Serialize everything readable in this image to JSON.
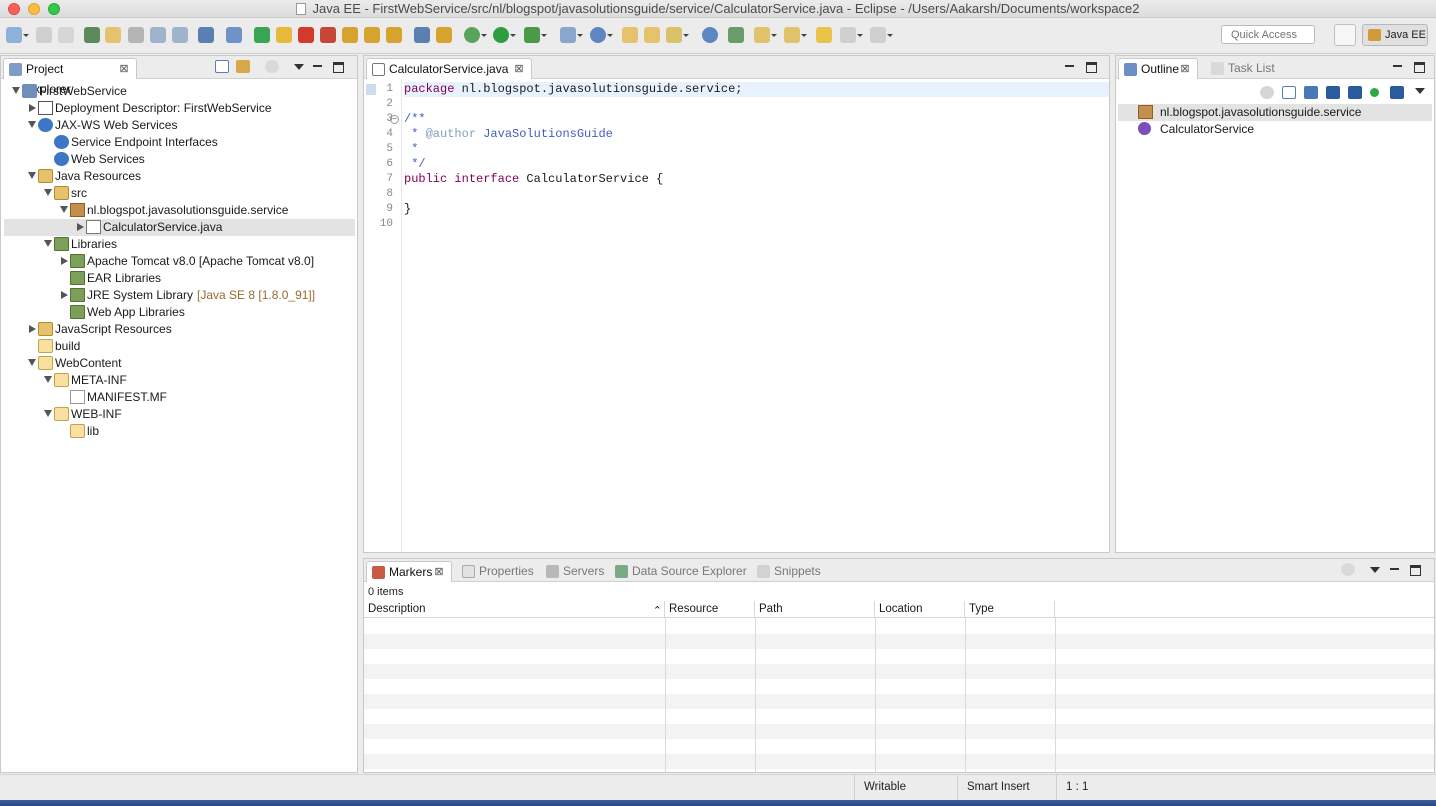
{
  "window": {
    "title": "Java EE - FirstWebService/src/nl/blogspot/javasolutionsguide/service/CalculatorService.java - Eclipse - /Users/Aakarsh/Documents/workspace2"
  },
  "toolbar": {
    "quick_access_placeholder": "Quick Access",
    "perspective_label": "Java EE"
  },
  "project_explorer": {
    "tab_label": "Project Explorer",
    "tree": [
      {
        "label": "FirstWebService",
        "depth": 0,
        "twisty": "down",
        "icon": "project-icon"
      },
      {
        "label": "Deployment Descriptor: FirstWebService",
        "depth": 1,
        "twisty": "right",
        "icon": "deployment-descriptor-icon"
      },
      {
        "label": "JAX-WS Web Services",
        "depth": 1,
        "twisty": "down",
        "icon": "web-services-icon"
      },
      {
        "label": "Service Endpoint Interfaces",
        "depth": 2,
        "twisty": "none",
        "icon": "interfaces-icon"
      },
      {
        "label": "Web Services",
        "depth": 2,
        "twisty": "none",
        "icon": "web-services-icon"
      },
      {
        "label": "Java Resources",
        "depth": 1,
        "twisty": "down",
        "icon": "java-resources-icon"
      },
      {
        "label": "src",
        "depth": 2,
        "twisty": "down",
        "icon": "source-folder-icon"
      },
      {
        "label": "nl.blogspot.javasolutionsguide.service",
        "depth": 3,
        "twisty": "down",
        "icon": "package-icon"
      },
      {
        "label": "CalculatorService.java",
        "depth": 4,
        "twisty": "right",
        "icon": "java-file-icon",
        "selected": true
      },
      {
        "label": "Libraries",
        "depth": 2,
        "twisty": "down",
        "icon": "libraries-icon"
      },
      {
        "label": "Apache Tomcat v8.0 [Apache Tomcat v8.0]",
        "depth": 3,
        "twisty": "right",
        "icon": "library-icon"
      },
      {
        "label": "EAR Libraries",
        "depth": 3,
        "twisty": "none",
        "icon": "library-icon"
      },
      {
        "label": "JRE System Library",
        "decoration": "[Java SE 8 [1.8.0_91]]",
        "depth": 3,
        "twisty": "right",
        "icon": "library-icon"
      },
      {
        "label": "Web App Libraries",
        "depth": 3,
        "twisty": "none",
        "icon": "library-icon"
      },
      {
        "label": "JavaScript Resources",
        "depth": 1,
        "twisty": "right",
        "icon": "javascript-resources-icon"
      },
      {
        "label": "build",
        "depth": 1,
        "twisty": "none",
        "icon": "folder-icon"
      },
      {
        "label": "WebContent",
        "depth": 1,
        "twisty": "down",
        "icon": "folder-icon"
      },
      {
        "label": "META-INF",
        "depth": 2,
        "twisty": "down",
        "icon": "folder-icon"
      },
      {
        "label": "MANIFEST.MF",
        "depth": 3,
        "twisty": "none",
        "icon": "file-icon"
      },
      {
        "label": "WEB-INF",
        "depth": 2,
        "twisty": "down",
        "icon": "folder-icon"
      },
      {
        "label": "lib",
        "depth": 3,
        "twisty": "none",
        "icon": "folder-icon"
      }
    ]
  },
  "editor": {
    "tab_label": "CalculatorService.java",
    "lines": [
      {
        "n": "1",
        "tokens": [
          {
            "t": "package",
            "c": "kw"
          },
          {
            "t": " nl.blogspot.javasolutionsguide.service;",
            "c": ""
          }
        ]
      },
      {
        "n": "2",
        "tokens": []
      },
      {
        "n": "3",
        "tokens": [
          {
            "t": "/**",
            "c": "cm"
          }
        ]
      },
      {
        "n": "4",
        "tokens": [
          {
            "t": " * ",
            "c": "cm"
          },
          {
            "t": "@author",
            "c": "tag"
          },
          {
            "t": " JavaSolutionsGuide",
            "c": "cm"
          }
        ]
      },
      {
        "n": "5",
        "tokens": [
          {
            "t": " *",
            "c": "cm"
          }
        ]
      },
      {
        "n": "6",
        "tokens": [
          {
            "t": " */",
            "c": "cm"
          }
        ]
      },
      {
        "n": "7",
        "tokens": [
          {
            "t": "public",
            "c": "kw"
          },
          {
            "t": " ",
            "c": ""
          },
          {
            "t": "interface",
            "c": "kw"
          },
          {
            "t": " CalculatorService {",
            "c": ""
          }
        ]
      },
      {
        "n": "8",
        "tokens": []
      },
      {
        "n": "9",
        "tokens": [
          {
            "t": "}",
            "c": ""
          }
        ]
      },
      {
        "n": "10",
        "tokens": []
      }
    ]
  },
  "outline": {
    "tabs": [
      "Outline",
      "Task List"
    ],
    "items": [
      {
        "label": "nl.blogspot.javasolutionsguide.service",
        "icon": "package-icon",
        "selected": true
      },
      {
        "label": "CalculatorService",
        "icon": "interface-icon"
      }
    ]
  },
  "bottom": {
    "tabs": [
      "Markers",
      "Properties",
      "Servers",
      "Data Source Explorer",
      "Snippets"
    ],
    "items_count": "0 items",
    "columns": [
      "Description",
      "Resource",
      "Path",
      "Location",
      "Type"
    ]
  },
  "status": {
    "writable": "Writable",
    "insert_mode": "Smart Insert",
    "position": "1 : 1"
  },
  "colors": {
    "keyword": "#7f0055",
    "comment": "#3f5fbf",
    "javadoc_tag": "#7f9fbf",
    "current_line": "#e8f2fe"
  }
}
